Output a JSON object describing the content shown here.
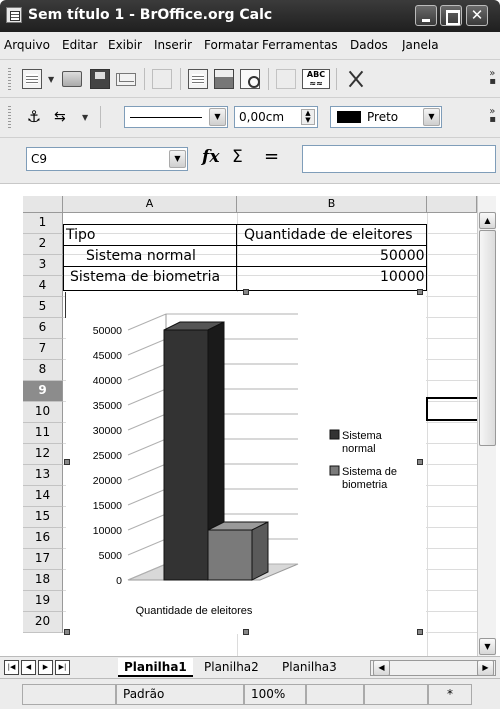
{
  "window": {
    "title": "Sem título 1 - BrOffice.org Calc"
  },
  "menu": [
    {
      "label": "Arquivo"
    },
    {
      "label": "Editar"
    },
    {
      "label": "Exibir"
    },
    {
      "label": "Inserir"
    },
    {
      "label": "Formatar"
    },
    {
      "label": "Ferramentas"
    },
    {
      "label": "Dados"
    },
    {
      "label": "Janela"
    }
  ],
  "toolbar_icons": [
    "new-document-icon",
    "open-folder-icon",
    "save-icon",
    "email-icon",
    "edit-file-icon",
    "export-pdf-icon",
    "print-icon",
    "page-preview-icon",
    "spellcheck-icon",
    "autospellcheck-icon",
    "cut-icon"
  ],
  "drawing_toolbar": {
    "line_style": "",
    "line_width": "0,00cm",
    "line_color": "Preto",
    "line_color_hex": "#000000"
  },
  "formula_bar": {
    "name_box": "C9",
    "function_wizard": "fx",
    "sum_symbol": "Σ",
    "equals_symbol": "=",
    "formula": ""
  },
  "columns": [
    "A",
    "B"
  ],
  "rows": [
    "1",
    "2",
    "3",
    "4",
    "5",
    "6",
    "7",
    "8",
    "9",
    "10",
    "11",
    "12",
    "13",
    "14",
    "15",
    "16",
    "17",
    "18",
    "19",
    "20"
  ],
  "active_row": "9",
  "cells": {
    "a1": "Tipo",
    "b1": "Quantidade de eleitores",
    "a2": "Sistema normal",
    "b2": "50000",
    "a3": "Sistema de biometria",
    "b3": "10000"
  },
  "chart_data": {
    "type": "bar",
    "categories": [
      "Quantidade de eleitores"
    ],
    "series": [
      {
        "name": "Sistema normal",
        "values": [
          50000
        ],
        "color": "#333333"
      },
      {
        "name": "Sistema de biometria",
        "values": [
          10000
        ],
        "color": "#7a7a7a"
      }
    ],
    "y_ticks": [
      "0",
      "5000",
      "10000",
      "15000",
      "20000",
      "25000",
      "30000",
      "35000",
      "40000",
      "45000",
      "50000"
    ],
    "ylim": [
      0,
      50000
    ],
    "xlabel": "Quantidade de eleitores",
    "legend_position": "right",
    "style": "3d",
    "grid": true
  },
  "sheets": [
    {
      "label": "Planilha1",
      "active": true
    },
    {
      "label": "Planilha2",
      "active": false
    },
    {
      "label": "Planilha3",
      "active": false
    }
  ],
  "status": {
    "page_style": "Padrão",
    "zoom": "100%",
    "insert_mode": "",
    "modified": "*"
  }
}
